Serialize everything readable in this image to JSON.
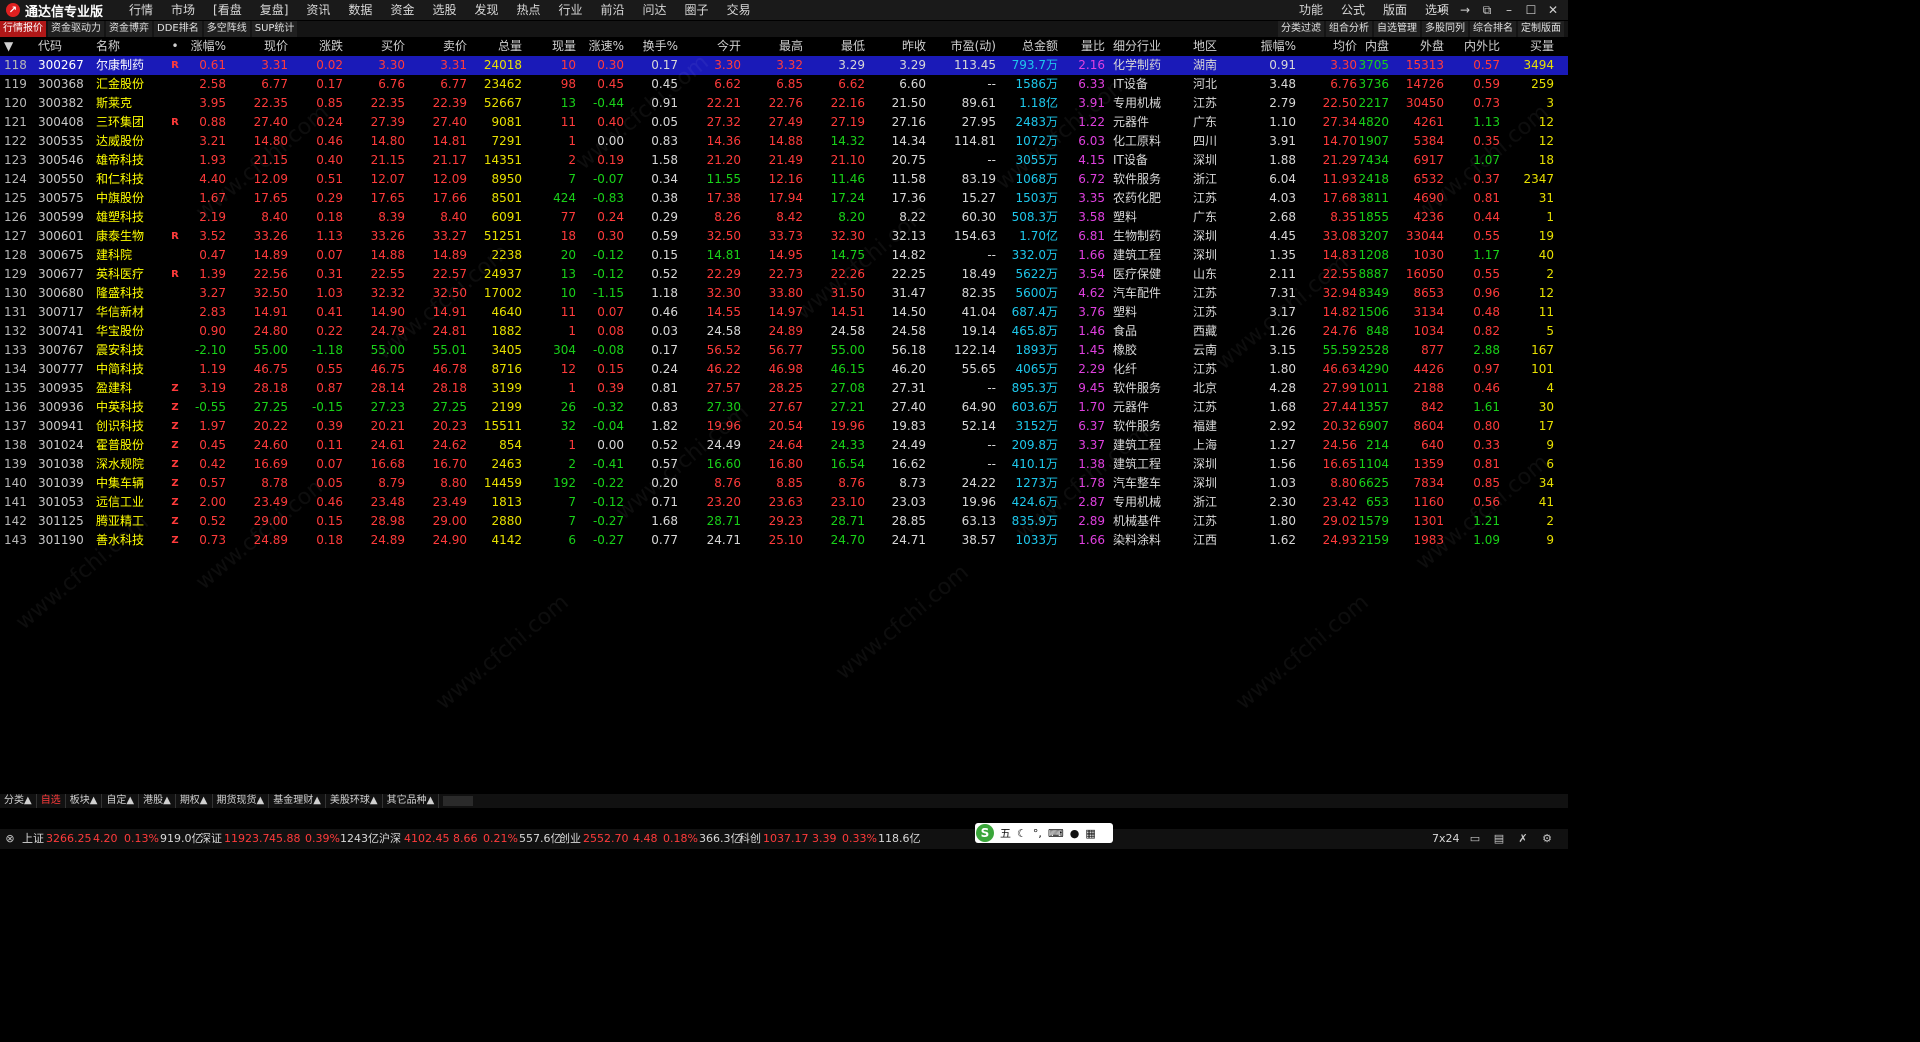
{
  "app": {
    "title": "通达信专业版"
  },
  "menu": [
    "行情",
    "市场",
    "[看盘",
    "复盘]",
    "资讯",
    "数据",
    "资金",
    "选股",
    "发现",
    "热点",
    "行业",
    "前沿",
    "问达",
    "圈子",
    "交易"
  ],
  "menu_right": [
    "功能",
    "公式",
    "版面",
    "选项"
  ],
  "window_controls": {
    "back": "←",
    "forward": "→",
    "restore": "⧉",
    "minimize": "–",
    "maximize": "☐",
    "close": "✕"
  },
  "toolbar_left": [
    "行情报价",
    "资金驱动力",
    "资金博弈",
    "DDE排名",
    "多空阵线",
    "SUP统计"
  ],
  "toolbar_right": [
    "分类过滤",
    "组合分析",
    "自选管理",
    "多股同列",
    "综合排名",
    "定制版面"
  ],
  "headers": {
    "code": "代码",
    "name": "名称",
    "dot": "•",
    "pct": "涨幅%",
    "price": "现价",
    "change": "涨跌",
    "bid": "买价",
    "ask": "卖价",
    "vol": "总量",
    "cur": "现量",
    "speed": "涨速%",
    "turnover": "换手%",
    "open": "今开",
    "high": "最高",
    "low": "最低",
    "prev": "昨收",
    "pe": "市盈(动)",
    "amount": "总金额",
    "vratio": "量比",
    "industry": "细分行业",
    "region": "地区",
    "amp": "振幅%",
    "avg": "均价",
    "inner": "内盘",
    "outer": "外盘",
    "io": "内外比",
    "buyqty": "买量"
  },
  "rows": [
    {
      "idx": "118",
      "code": "300267",
      "name": "尔康制药",
      "flag": "R",
      "pct": "0.61",
      "price": "3.31",
      "change": "0.02",
      "bid": "3.30",
      "ask": "3.31",
      "vol": "24018",
      "cur": "10",
      "speed": "0.30",
      "turnover": "0.17",
      "open": "3.30",
      "high": "3.32",
      "low": "3.29",
      "prev": "3.29",
      "pe": "113.45",
      "amount": "793.7万",
      "vratio": "2.16",
      "industry": "化学制药",
      "region": "湖南",
      "amp": "0.91",
      "avg": "3.30",
      "inner": "3705",
      "outer": "15313",
      "io": "0.57",
      "buyqty": "3494"
    },
    {
      "idx": "119",
      "code": "300368",
      "name": "汇金股份",
      "flag": "",
      "pct": "2.58",
      "price": "6.77",
      "change": "0.17",
      "bid": "6.76",
      "ask": "6.77",
      "vol": "23462",
      "cur": "98",
      "speed": "0.45",
      "turnover": "0.45",
      "open": "6.62",
      "high": "6.85",
      "low": "6.62",
      "prev": "6.60",
      "pe": "--",
      "amount": "1586万",
      "vratio": "6.33",
      "industry": "IT设备",
      "region": "河北",
      "amp": "3.48",
      "avg": "6.76",
      "inner": "3736",
      "outer": "14726",
      "io": "0.59",
      "buyqty": "259"
    },
    {
      "idx": "120",
      "code": "300382",
      "name": "斯莱克",
      "flag": "",
      "pct": "3.95",
      "price": "22.35",
      "change": "0.85",
      "bid": "22.35",
      "ask": "22.39",
      "vol": "52667",
      "cur": "13",
      "speed": "-0.44",
      "turnover": "0.91",
      "open": "22.21",
      "high": "22.76",
      "low": "22.16",
      "prev": "21.50",
      "pe": "89.61",
      "amount": "1.18亿",
      "vratio": "3.91",
      "industry": "专用机械",
      "region": "江苏",
      "amp": "2.79",
      "avg": "22.50",
      "inner": "2217",
      "outer": "30450",
      "io": "0.73",
      "buyqty": "3"
    },
    {
      "idx": "121",
      "code": "300408",
      "name": "三环集团",
      "flag": "R",
      "pct": "0.88",
      "price": "27.40",
      "change": "0.24",
      "bid": "27.39",
      "ask": "27.40",
      "vol": "9081",
      "cur": "11",
      "speed": "0.40",
      "turnover": "0.05",
      "open": "27.32",
      "high": "27.49",
      "low": "27.19",
      "prev": "27.16",
      "pe": "27.95",
      "amount": "2483万",
      "vratio": "1.22",
      "industry": "元器件",
      "region": "广东",
      "amp": "1.10",
      "avg": "27.34",
      "inner": "4820",
      "outer": "4261",
      "io": "1.13",
      "buyqty": "12"
    },
    {
      "idx": "122",
      "code": "300535",
      "name": "达威股份",
      "flag": "",
      "pct": "3.21",
      "price": "14.80",
      "change": "0.46",
      "bid": "14.80",
      "ask": "14.81",
      "vol": "7291",
      "cur": "1",
      "speed": "0.00",
      "turnover": "0.83",
      "open": "14.36",
      "high": "14.88",
      "low": "14.32",
      "prev": "14.34",
      "pe": "114.81",
      "amount": "1072万",
      "vratio": "6.03",
      "industry": "化工原料",
      "region": "四川",
      "amp": "3.91",
      "avg": "14.70",
      "inner": "1907",
      "outer": "5384",
      "io": "0.35",
      "buyqty": "12"
    },
    {
      "idx": "123",
      "code": "300546",
      "name": "雄帝科技",
      "flag": "",
      "pct": "1.93",
      "price": "21.15",
      "change": "0.40",
      "bid": "21.15",
      "ask": "21.17",
      "vol": "14351",
      "cur": "2",
      "speed": "0.19",
      "turnover": "1.58",
      "open": "21.20",
      "high": "21.49",
      "low": "21.10",
      "prev": "20.75",
      "pe": "--",
      "amount": "3055万",
      "vratio": "4.15",
      "industry": "IT设备",
      "region": "深圳",
      "amp": "1.88",
      "avg": "21.29",
      "inner": "7434",
      "outer": "6917",
      "io": "1.07",
      "buyqty": "18"
    },
    {
      "idx": "124",
      "code": "300550",
      "name": "和仁科技",
      "flag": "",
      "pct": "4.40",
      "price": "12.09",
      "change": "0.51",
      "bid": "12.07",
      "ask": "12.09",
      "vol": "8950",
      "cur": "7",
      "speed": "-0.07",
      "turnover": "0.34",
      "open": "11.55",
      "high": "12.16",
      "low": "11.46",
      "prev": "11.58",
      "pe": "83.19",
      "amount": "1068万",
      "vratio": "6.72",
      "industry": "软件服务",
      "region": "浙江",
      "amp": "6.04",
      "avg": "11.93",
      "inner": "2418",
      "outer": "6532",
      "io": "0.37",
      "buyqty": "2347"
    },
    {
      "idx": "125",
      "code": "300575",
      "name": "中旗股份",
      "flag": "",
      "pct": "1.67",
      "price": "17.65",
      "change": "0.29",
      "bid": "17.65",
      "ask": "17.66",
      "vol": "8501",
      "cur": "424",
      "speed": "-0.83",
      "turnover": "0.38",
      "open": "17.38",
      "high": "17.94",
      "low": "17.24",
      "prev": "17.36",
      "pe": "15.27",
      "amount": "1503万",
      "vratio": "3.35",
      "industry": "农药化肥",
      "region": "江苏",
      "amp": "4.03",
      "avg": "17.68",
      "inner": "3811",
      "outer": "4690",
      "io": "0.81",
      "buyqty": "31"
    },
    {
      "idx": "126",
      "code": "300599",
      "name": "雄塑科技",
      "flag": "",
      "pct": "2.19",
      "price": "8.40",
      "change": "0.18",
      "bid": "8.39",
      "ask": "8.40",
      "vol": "6091",
      "cur": "77",
      "speed": "0.24",
      "turnover": "0.29",
      "open": "8.26",
      "high": "8.42",
      "low": "8.20",
      "prev": "8.22",
      "pe": "60.30",
      "amount": "508.3万",
      "vratio": "3.58",
      "industry": "塑料",
      "region": "广东",
      "amp": "2.68",
      "avg": "8.35",
      "inner": "1855",
      "outer": "4236",
      "io": "0.44",
      "buyqty": "1"
    },
    {
      "idx": "127",
      "code": "300601",
      "name": "康泰生物",
      "flag": "R",
      "pct": "3.52",
      "price": "33.26",
      "change": "1.13",
      "bid": "33.26",
      "ask": "33.27",
      "vol": "51251",
      "cur": "18",
      "speed": "0.30",
      "turnover": "0.59",
      "open": "32.50",
      "high": "33.73",
      "low": "32.30",
      "prev": "32.13",
      "pe": "154.63",
      "amount": "1.70亿",
      "vratio": "6.81",
      "industry": "生物制药",
      "region": "深圳",
      "amp": "4.45",
      "avg": "33.08",
      "inner": "3207",
      "outer": "33044",
      "io": "0.55",
      "buyqty": "19"
    },
    {
      "idx": "128",
      "code": "300675",
      "name": "建科院",
      "flag": "",
      "pct": "0.47",
      "price": "14.89",
      "change": "0.07",
      "bid": "14.88",
      "ask": "14.89",
      "vol": "2238",
      "cur": "20",
      "speed": "-0.12",
      "turnover": "0.15",
      "open": "14.81",
      "high": "14.95",
      "low": "14.75",
      "prev": "14.82",
      "pe": "--",
      "amount": "332.0万",
      "vratio": "1.66",
      "industry": "建筑工程",
      "region": "深圳",
      "amp": "1.35",
      "avg": "14.83",
      "inner": "1208",
      "outer": "1030",
      "io": "1.17",
      "buyqty": "40"
    },
    {
      "idx": "129",
      "code": "300677",
      "name": "英科医疗",
      "flag": "R",
      "pct": "1.39",
      "price": "22.56",
      "change": "0.31",
      "bid": "22.55",
      "ask": "22.57",
      "vol": "24937",
      "cur": "13",
      "speed": "-0.12",
      "turnover": "0.52",
      "open": "22.29",
      "high": "22.73",
      "low": "22.26",
      "prev": "22.25",
      "pe": "18.49",
      "amount": "5622万",
      "vratio": "3.54",
      "industry": "医疗保健",
      "region": "山东",
      "amp": "2.11",
      "avg": "22.55",
      "inner": "8887",
      "outer": "16050",
      "io": "0.55",
      "buyqty": "2"
    },
    {
      "idx": "130",
      "code": "300680",
      "name": "隆盛科技",
      "flag": "",
      "pct": "3.27",
      "price": "32.50",
      "change": "1.03",
      "bid": "32.32",
      "ask": "32.50",
      "vol": "17002",
      "cur": "10",
      "speed": "-1.15",
      "turnover": "1.18",
      "open": "32.30",
      "high": "33.80",
      "low": "31.50",
      "prev": "31.47",
      "pe": "82.35",
      "amount": "5600万",
      "vratio": "4.62",
      "industry": "汽车配件",
      "region": "江苏",
      "amp": "7.31",
      "avg": "32.94",
      "inner": "8349",
      "outer": "8653",
      "io": "0.96",
      "buyqty": "12"
    },
    {
      "idx": "131",
      "code": "300717",
      "name": "华信新材",
      "flag": "",
      "pct": "2.83",
      "price": "14.91",
      "change": "0.41",
      "bid": "14.90",
      "ask": "14.91",
      "vol": "4640",
      "cur": "11",
      "speed": "0.07",
      "turnover": "0.46",
      "open": "14.55",
      "high": "14.97",
      "low": "14.51",
      "prev": "14.50",
      "pe": "41.04",
      "amount": "687.4万",
      "vratio": "3.76",
      "industry": "塑料",
      "region": "江苏",
      "amp": "3.17",
      "avg": "14.82",
      "inner": "1506",
      "outer": "3134",
      "io": "0.48",
      "buyqty": "11"
    },
    {
      "idx": "132",
      "code": "300741",
      "name": "华宝股份",
      "flag": "",
      "pct": "0.90",
      "price": "24.80",
      "change": "0.22",
      "bid": "24.79",
      "ask": "24.81",
      "vol": "1882",
      "cur": "1",
      "speed": "0.08",
      "turnover": "0.03",
      "open": "24.58",
      "high": "24.89",
      "low": "24.58",
      "prev": "24.58",
      "pe": "19.14",
      "amount": "465.8万",
      "vratio": "1.46",
      "industry": "食品",
      "region": "西藏",
      "amp": "1.26",
      "avg": "24.76",
      "inner": "848",
      "outer": "1034",
      "io": "0.82",
      "buyqty": "5"
    },
    {
      "idx": "133",
      "code": "300767",
      "name": "震安科技",
      "flag": "",
      "pct": "-2.10",
      "price": "55.00",
      "change": "-1.18",
      "bid": "55.00",
      "ask": "55.01",
      "vol": "3405",
      "cur": "304",
      "speed": "-0.08",
      "turnover": "0.17",
      "open": "56.52",
      "high": "56.77",
      "low": "55.00",
      "prev": "56.18",
      "pe": "122.14",
      "amount": "1893万",
      "vratio": "1.45",
      "industry": "橡胶",
      "region": "云南",
      "amp": "3.15",
      "avg": "55.59",
      "inner": "2528",
      "outer": "877",
      "io": "2.88",
      "buyqty": "167"
    },
    {
      "idx": "134",
      "code": "300777",
      "name": "中简科技",
      "flag": "",
      "pct": "1.19",
      "price": "46.75",
      "change": "0.55",
      "bid": "46.75",
      "ask": "46.78",
      "vol": "8716",
      "cur": "12",
      "speed": "0.15",
      "turnover": "0.24",
      "open": "46.22",
      "high": "46.98",
      "low": "46.15",
      "prev": "46.20",
      "pe": "55.65",
      "amount": "4065万",
      "vratio": "2.29",
      "industry": "化纤",
      "region": "江苏",
      "amp": "1.80",
      "avg": "46.63",
      "inner": "4290",
      "outer": "4426",
      "io": "0.97",
      "buyqty": "101"
    },
    {
      "idx": "135",
      "code": "300935",
      "name": "盈建科",
      "flag": "Z",
      "pct": "3.19",
      "price": "28.18",
      "change": "0.87",
      "bid": "28.14",
      "ask": "28.18",
      "vol": "3199",
      "cur": "1",
      "speed": "0.39",
      "turnover": "0.81",
      "open": "27.57",
      "high": "28.25",
      "low": "27.08",
      "prev": "27.31",
      "pe": "--",
      "amount": "895.3万",
      "vratio": "9.45",
      "industry": "软件服务",
      "region": "北京",
      "amp": "4.28",
      "avg": "27.99",
      "inner": "1011",
      "outer": "2188",
      "io": "0.46",
      "buyqty": "4"
    },
    {
      "idx": "136",
      "code": "300936",
      "name": "中英科技",
      "flag": "Z",
      "pct": "-0.55",
      "price": "27.25",
      "change": "-0.15",
      "bid": "27.23",
      "ask": "27.25",
      "vol": "2199",
      "cur": "26",
      "speed": "-0.32",
      "turnover": "0.83",
      "open": "27.30",
      "high": "27.67",
      "low": "27.21",
      "prev": "27.40",
      "pe": "64.90",
      "amount": "603.6万",
      "vratio": "1.70",
      "industry": "元器件",
      "region": "江苏",
      "amp": "1.68",
      "avg": "27.44",
      "inner": "1357",
      "outer": "842",
      "io": "1.61",
      "buyqty": "30"
    },
    {
      "idx": "137",
      "code": "300941",
      "name": "创识科技",
      "flag": "Z",
      "pct": "1.97",
      "price": "20.22",
      "change": "0.39",
      "bid": "20.21",
      "ask": "20.23",
      "vol": "15511",
      "cur": "32",
      "speed": "-0.04",
      "turnover": "1.82",
      "open": "19.96",
      "high": "20.54",
      "low": "19.96",
      "prev": "19.83",
      "pe": "52.14",
      "amount": "3152万",
      "vratio": "6.37",
      "industry": "软件服务",
      "region": "福建",
      "amp": "2.92",
      "avg": "20.32",
      "inner": "6907",
      "outer": "8604",
      "io": "0.80",
      "buyqty": "17"
    },
    {
      "idx": "138",
      "code": "301024",
      "name": "霍普股份",
      "flag": "Z",
      "pct": "0.45",
      "price": "24.60",
      "change": "0.11",
      "bid": "24.61",
      "ask": "24.62",
      "vol": "854",
      "cur": "1",
      "speed": "0.00",
      "turnover": "0.52",
      "open": "24.49",
      "high": "24.64",
      "low": "24.33",
      "prev": "24.49",
      "pe": "--",
      "amount": "209.8万",
      "vratio": "3.37",
      "industry": "建筑工程",
      "region": "上海",
      "amp": "1.27",
      "avg": "24.56",
      "inner": "214",
      "outer": "640",
      "io": "0.33",
      "buyqty": "9"
    },
    {
      "idx": "139",
      "code": "301038",
      "name": "深水规院",
      "flag": "Z",
      "pct": "0.42",
      "price": "16.69",
      "change": "0.07",
      "bid": "16.68",
      "ask": "16.70",
      "vol": "2463",
      "cur": "2",
      "speed": "-0.41",
      "turnover": "0.57",
      "open": "16.60",
      "high": "16.80",
      "low": "16.54",
      "prev": "16.62",
      "pe": "--",
      "amount": "410.1万",
      "vratio": "1.38",
      "industry": "建筑工程",
      "region": "深圳",
      "amp": "1.56",
      "avg": "16.65",
      "inner": "1104",
      "outer": "1359",
      "io": "0.81",
      "buyqty": "6"
    },
    {
      "idx": "140",
      "code": "301039",
      "name": "中集车辆",
      "flag": "Z",
      "pct": "0.57",
      "price": "8.78",
      "change": "0.05",
      "bid": "8.79",
      "ask": "8.80",
      "vol": "14459",
      "cur": "192",
      "speed": "-0.22",
      "turnover": "0.20",
      "open": "8.76",
      "high": "8.85",
      "low": "8.76",
      "prev": "8.73",
      "pe": "24.22",
      "amount": "1273万",
      "vratio": "1.78",
      "industry": "汽车整车",
      "region": "深圳",
      "amp": "1.03",
      "avg": "8.80",
      "inner": "6625",
      "outer": "7834",
      "io": "0.85",
      "buyqty": "34"
    },
    {
      "idx": "141",
      "code": "301053",
      "name": "远信工业",
      "flag": "Z",
      "pct": "2.00",
      "price": "23.49",
      "change": "0.46",
      "bid": "23.48",
      "ask": "23.49",
      "vol": "1813",
      "cur": "7",
      "speed": "-0.12",
      "turnover": "0.71",
      "open": "23.20",
      "high": "23.63",
      "low": "23.10",
      "prev": "23.03",
      "pe": "19.96",
      "amount": "424.6万",
      "vratio": "2.87",
      "industry": "专用机械",
      "region": "浙江",
      "amp": "2.30",
      "avg": "23.42",
      "inner": "653",
      "outer": "1160",
      "io": "0.56",
      "buyqty": "41"
    },
    {
      "idx": "142",
      "code": "301125",
      "name": "腾亚精工",
      "flag": "Z",
      "pct": "0.52",
      "price": "29.00",
      "change": "0.15",
      "bid": "28.98",
      "ask": "29.00",
      "vol": "2880",
      "cur": "7",
      "speed": "-0.27",
      "turnover": "1.68",
      "open": "28.71",
      "high": "29.23",
      "low": "28.71",
      "prev": "28.85",
      "pe": "63.13",
      "amount": "835.9万",
      "vratio": "2.89",
      "industry": "机械基件",
      "region": "江苏",
      "amp": "1.80",
      "avg": "29.02",
      "inner": "1579",
      "outer": "1301",
      "io": "1.21",
      "buyqty": "2"
    },
    {
      "idx": "143",
      "code": "301190",
      "name": "善水科技",
      "flag": "Z",
      "pct": "0.73",
      "price": "24.89",
      "change": "0.18",
      "bid": "24.89",
      "ask": "24.90",
      "vol": "4142",
      "cur": "6",
      "speed": "-0.27",
      "turnover": "0.77",
      "open": "24.71",
      "high": "25.10",
      "low": "24.70",
      "prev": "24.71",
      "pe": "38.57",
      "amount": "1033万",
      "vratio": "1.66",
      "industry": "染料涂料",
      "region": "江西",
      "amp": "1.62",
      "avg": "24.93",
      "inner": "2159",
      "outer": "1983",
      "io": "1.09",
      "buyqty": "9"
    }
  ],
  "bottom_tabs": [
    "分类▲",
    "自选",
    "板块▲",
    "自定▲",
    "港股▲",
    "期权▲",
    "期货现货▲",
    "基金理财▲",
    "美股环球▲",
    "其它品种▲"
  ],
  "status": {
    "sh_label": "上证",
    "sh_value": "3266.25",
    "sh_change": "4.20",
    "sh_pct": "0.13%",
    "sh_amount": "919.0亿",
    "sz_label": "深证",
    "sz_value": "11923.7",
    "sz_change": "45.88",
    "sz_pct": "0.39%",
    "sz_amount": "1243亿",
    "hs_label": "沪深",
    "hs_value": "4102.45",
    "hs_change": "8.66",
    "hs_pct": "0.21%",
    "hs_amount": "557.6亿",
    "cy_label": "创业",
    "cy_value": "2552.70",
    "cy_change": "4.48",
    "cy_pct": "0.18%",
    "cy_amount": "366.3亿",
    "kc_label": "科创",
    "kc_value": "1037.17",
    "kc_change": "3.39",
    "kc_pct": "0.33%",
    "kc_amount": "118.6亿",
    "service": "7x24"
  },
  "ime": {
    "logo": "S",
    "items": [
      "五",
      "☾",
      "°,",
      "⌨",
      "●",
      "▦"
    ]
  },
  "watermark": "www.cfchi.com"
}
